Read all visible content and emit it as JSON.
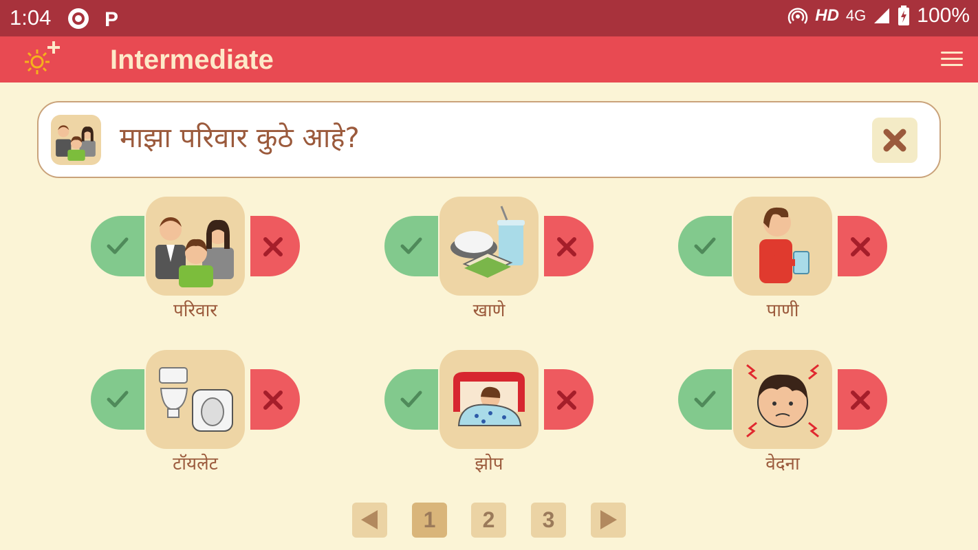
{
  "status_bar": {
    "time": "1:04",
    "network": "HD",
    "signal": "4G",
    "battery": "100%"
  },
  "app_bar": {
    "title": "Intermediate"
  },
  "sentence": {
    "text": "माझा परिवार कुठे आहे?"
  },
  "cards": [
    {
      "label": "परिवार",
      "icon": "family-icon"
    },
    {
      "label": "खाणे",
      "icon": "food-icon"
    },
    {
      "label": "पाणी",
      "icon": "water-icon"
    },
    {
      "label": "टॉयलेट",
      "icon": "toilet-icon"
    },
    {
      "label": "झोप",
      "icon": "sleep-icon"
    },
    {
      "label": "वेदना",
      "icon": "pain-icon"
    }
  ],
  "pagination": {
    "pages": [
      "1",
      "2",
      "3"
    ],
    "current": "1"
  },
  "colors": {
    "status_bar": "#a8323c",
    "app_bar": "#e84a52",
    "background": "#fbf4d6",
    "tile": "#eed5a5",
    "yes": "#82c98d",
    "no": "#ee5a5f",
    "text": "#9b5a3c"
  }
}
